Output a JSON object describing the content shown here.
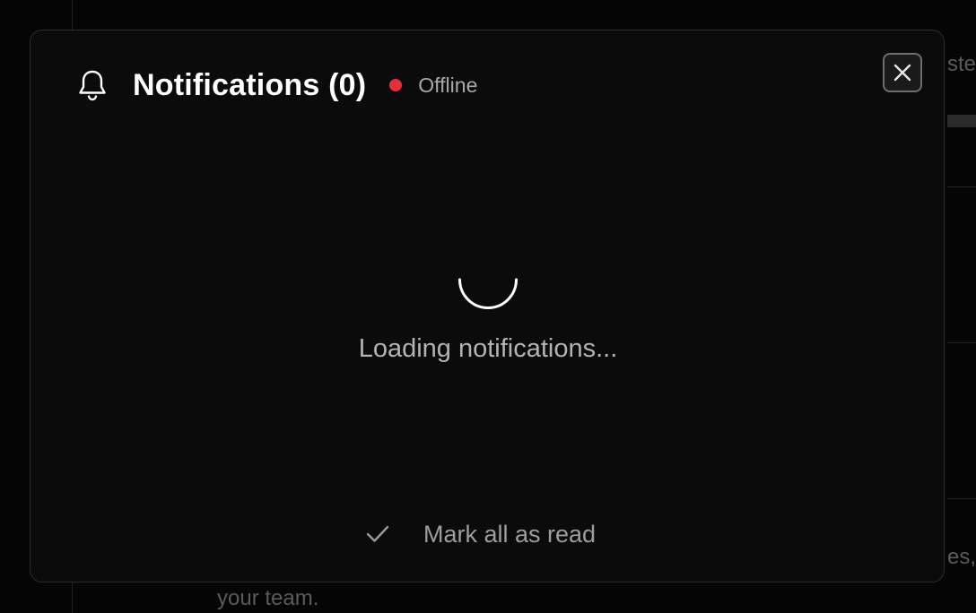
{
  "background": {
    "top_partial_text": "ste",
    "right_partial_text": "es,",
    "bottom_partial_text": "your team."
  },
  "modal": {
    "title": "Notifications (0)",
    "status": {
      "text": "Offline",
      "color": "#e5303a"
    },
    "close_icon": "close-icon",
    "header_icon": "bell-icon",
    "loading": {
      "text": "Loading notifications..."
    },
    "footer": {
      "mark_all_label": "Mark all as read",
      "icon": "check-icon"
    }
  }
}
